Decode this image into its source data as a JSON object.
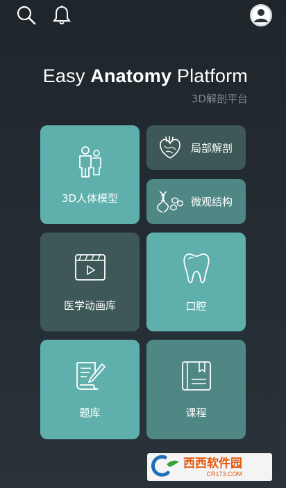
{
  "header": {
    "search_icon": "search-icon",
    "bell_icon": "bell-icon",
    "avatar_icon": "user-avatar-icon"
  },
  "app": {
    "title_prefix": "Easy ",
    "title_bold": "Anatomy",
    "title_suffix": " Platform",
    "subtitle": "3D解剖平台"
  },
  "tiles": [
    {
      "label": "3D人体模型",
      "icon": "human-body-icon"
    },
    {
      "label": "局部解剖",
      "icon": "heart-icon"
    },
    {
      "label": "微观结构",
      "icon": "dna-icon"
    },
    {
      "label": "医学动画库",
      "icon": "video-icon"
    },
    {
      "label": "口腔",
      "icon": "tooth-icon"
    },
    {
      "label": "题库",
      "icon": "question-bank-icon"
    },
    {
      "label": "课程",
      "icon": "book-icon"
    }
  ],
  "colors": {
    "tile_light": "#5fb0ad",
    "tile_dark": "#3d5857",
    "tile_mid": "#4f8785",
    "background": "#1e262c"
  },
  "watermark": {
    "brand": "西西软件园",
    "url": "CR173.COM"
  }
}
